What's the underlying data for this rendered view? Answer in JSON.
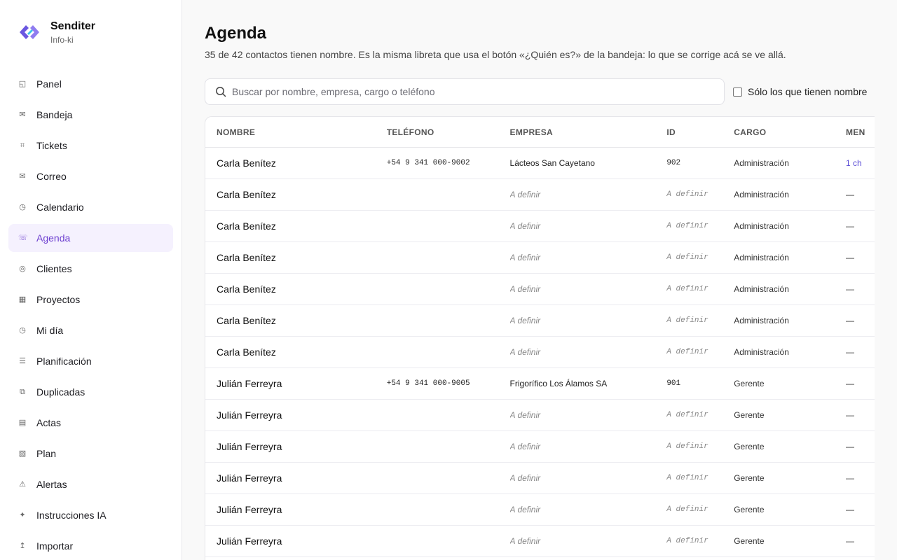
{
  "app": {
    "name": "Senditer",
    "workspace": "Info-ki",
    "accent": "#6d3fd0",
    "logo_color": "#6a57e0"
  },
  "sidebar": {
    "items": [
      {
        "label": "Panel",
        "icon": "panel-icon",
        "glyph": "◱"
      },
      {
        "label": "Bandeja",
        "icon": "inbox-icon",
        "glyph": "✉"
      },
      {
        "label": "Tickets",
        "icon": "hash-icon",
        "glyph": "⌗"
      },
      {
        "label": "Correo",
        "icon": "mail-icon",
        "glyph": "✉"
      },
      {
        "label": "Calendario",
        "icon": "clock-icon",
        "glyph": "◷"
      },
      {
        "label": "Agenda",
        "icon": "phone-icon",
        "glyph": "☏",
        "active": true
      },
      {
        "label": "Clientes",
        "icon": "target-icon",
        "glyph": "◎"
      },
      {
        "label": "Proyectos",
        "icon": "grid-icon",
        "glyph": "▦"
      },
      {
        "label": "Mi día",
        "icon": "clock-icon",
        "glyph": "◷"
      },
      {
        "label": "Planificación",
        "icon": "list-icon",
        "glyph": "☰"
      },
      {
        "label": "Duplicadas",
        "icon": "copy-icon",
        "glyph": "⧉"
      },
      {
        "label": "Actas",
        "icon": "document-icon",
        "glyph": "▤"
      },
      {
        "label": "Plan",
        "icon": "plan-icon",
        "glyph": "▧"
      },
      {
        "label": "Alertas",
        "icon": "warning-icon",
        "glyph": "⚠"
      },
      {
        "label": "Instrucciones IA",
        "icon": "sparkle-icon",
        "glyph": "✦"
      },
      {
        "label": "Importar",
        "icon": "upload-icon",
        "glyph": "↥"
      }
    ]
  },
  "page": {
    "title": "Agenda",
    "subtitle": "35 de 42 contactos tienen nombre. Es la misma libreta que usa el botón «¿Quién es?» de la bandeja: lo que se corrige acá se ve allá."
  },
  "search": {
    "placeholder": "Buscar por nombre, empresa, cargo o teléfono",
    "value": ""
  },
  "filter": {
    "label": "Sólo los que tienen nombre",
    "checked": false
  },
  "table": {
    "columns": [
      "NOMBRE",
      "TELÉFONO",
      "EMPRESA",
      "ID",
      "CARGO",
      "MEN"
    ],
    "rows": [
      {
        "name": "Carla Benítez",
        "phone": "+54 9 341 000-9002",
        "company": "Lácteos San Cayetano",
        "id": "902",
        "role": "Administración",
        "men": "1 ch"
      },
      {
        "name": "Carla Benítez",
        "phone": "",
        "company": "A definir",
        "id": "A definir",
        "role": "Administración",
        "men": "—"
      },
      {
        "name": "Carla Benítez",
        "phone": "",
        "company": "A definir",
        "id": "A definir",
        "role": "Administración",
        "men": "—"
      },
      {
        "name": "Carla Benítez",
        "phone": "",
        "company": "A definir",
        "id": "A definir",
        "role": "Administración",
        "men": "—"
      },
      {
        "name": "Carla Benítez",
        "phone": "",
        "company": "A definir",
        "id": "A definir",
        "role": "Administración",
        "men": "—"
      },
      {
        "name": "Carla Benítez",
        "phone": "",
        "company": "A definir",
        "id": "A definir",
        "role": "Administración",
        "men": "—"
      },
      {
        "name": "Carla Benítez",
        "phone": "",
        "company": "A definir",
        "id": "A definir",
        "role": "Administración",
        "men": "—"
      },
      {
        "name": "Julián Ferreyra",
        "phone": "+54 9 341 000-9005",
        "company": "Frigorífico Los Álamos SA",
        "id": "901",
        "role": "Gerente",
        "men": "—"
      },
      {
        "name": "Julián Ferreyra",
        "phone": "",
        "company": "A definir",
        "id": "A definir",
        "role": "Gerente",
        "men": "—"
      },
      {
        "name": "Julián Ferreyra",
        "phone": "",
        "company": "A definir",
        "id": "A definir",
        "role": "Gerente",
        "men": "—"
      },
      {
        "name": "Julián Ferreyra",
        "phone": "",
        "company": "A definir",
        "id": "A definir",
        "role": "Gerente",
        "men": "—"
      },
      {
        "name": "Julián Ferreyra",
        "phone": "",
        "company": "A definir",
        "id": "A definir",
        "role": "Gerente",
        "men": "—"
      },
      {
        "name": "Julián Ferreyra",
        "phone": "",
        "company": "A definir",
        "id": "A definir",
        "role": "Gerente",
        "men": "—"
      }
    ]
  }
}
